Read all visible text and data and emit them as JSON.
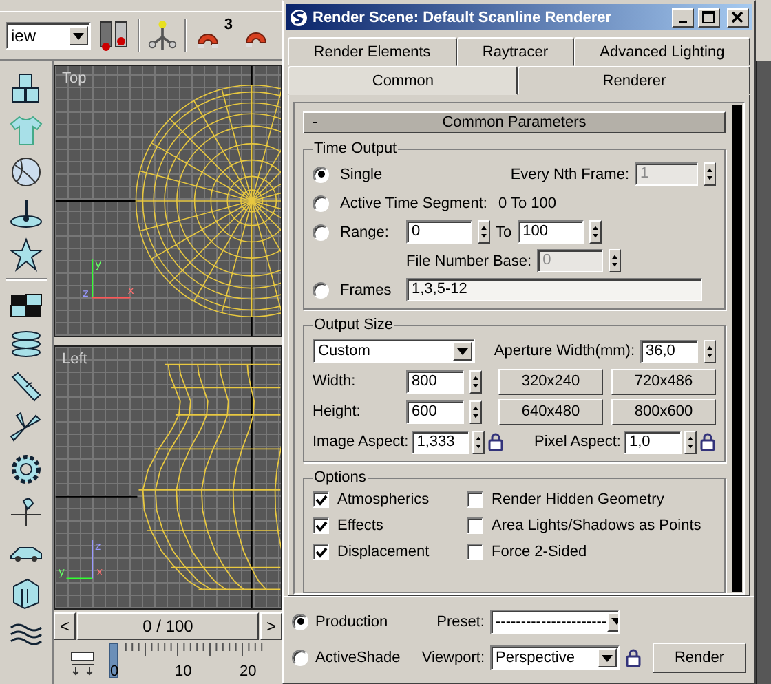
{
  "toolbar": {
    "view_select": "iew",
    "snap_count": "3"
  },
  "viewports": [
    {
      "kind": "top",
      "label": "Top",
      "axes": {
        "up": "y",
        "origin": "z",
        "right": "x"
      }
    },
    {
      "kind": "left",
      "label": "Left",
      "axes": {
        "up": "z",
        "origin": "x",
        "left": "y"
      }
    }
  ],
  "time_slider": {
    "prev": "<",
    "position": "0 / 100",
    "next": ">"
  },
  "track_bar": {
    "ticks": [
      "0",
      "10",
      "20"
    ]
  },
  "dialog": {
    "title": "Render Scene: Default Scanline Renderer",
    "tab_rows": [
      [
        {
          "label": "Render Elements",
          "selected": false
        },
        {
          "label": "Raytracer",
          "selected": false
        },
        {
          "label": "Advanced Lighting",
          "selected": false
        }
      ],
      [
        {
          "label": "Common",
          "selected": true
        },
        {
          "label": "Renderer",
          "selected": false
        }
      ]
    ],
    "rollout": {
      "toggle": "-",
      "title": "Common Parameters"
    },
    "time_output": {
      "title": "Time Output",
      "modes": [
        {
          "label": "Single",
          "selected": true
        },
        {
          "label": "Active Time Segment:",
          "selected": false
        },
        {
          "label": "Range:",
          "selected": false
        },
        {
          "label": "Frames",
          "selected": false
        }
      ],
      "every_nth": {
        "label": "Every Nth Frame:",
        "value": "1",
        "disabled": true
      },
      "active_segment": "0 To 100",
      "range_start": "0",
      "range_to": "To",
      "range_end": "100",
      "file_number_base": {
        "label": "File Number Base:",
        "value": "0",
        "disabled": true
      },
      "frames": "1,3,5-12"
    },
    "output_size": {
      "title": "Output Size",
      "preset": "Custom",
      "aperture": {
        "label": "Aperture Width(mm):",
        "value": "36,0"
      },
      "width": {
        "label": "Width:",
        "value": "800"
      },
      "height": {
        "label": "Height:",
        "value": "600"
      },
      "presets": [
        "320x240",
        "720x486",
        "640x480",
        "800x600"
      ],
      "image_aspect": {
        "label": "Image Aspect:",
        "value": "1,333"
      },
      "pixel_aspect": {
        "label": "Pixel Aspect:",
        "value": "1,0"
      }
    },
    "options": {
      "title": "Options",
      "items": [
        {
          "label": "Atmospherics",
          "checked": true
        },
        {
          "label": "Render Hidden Geometry",
          "checked": false
        },
        {
          "label": "Effects",
          "checked": true
        },
        {
          "label": "Area Lights/Shadows as Points",
          "checked": false
        },
        {
          "label": "Displacement",
          "checked": true
        },
        {
          "label": "Force 2-Sided",
          "checked": false
        }
      ]
    },
    "render_mode": [
      {
        "label": "Production",
        "selected": true
      },
      {
        "label": "ActiveShade",
        "selected": false
      }
    ],
    "preset": {
      "label": "Preset:",
      "value": "----------------------"
    },
    "viewport": {
      "label": "Viewport:",
      "value": "Perspective"
    },
    "render_button": "Render"
  }
}
